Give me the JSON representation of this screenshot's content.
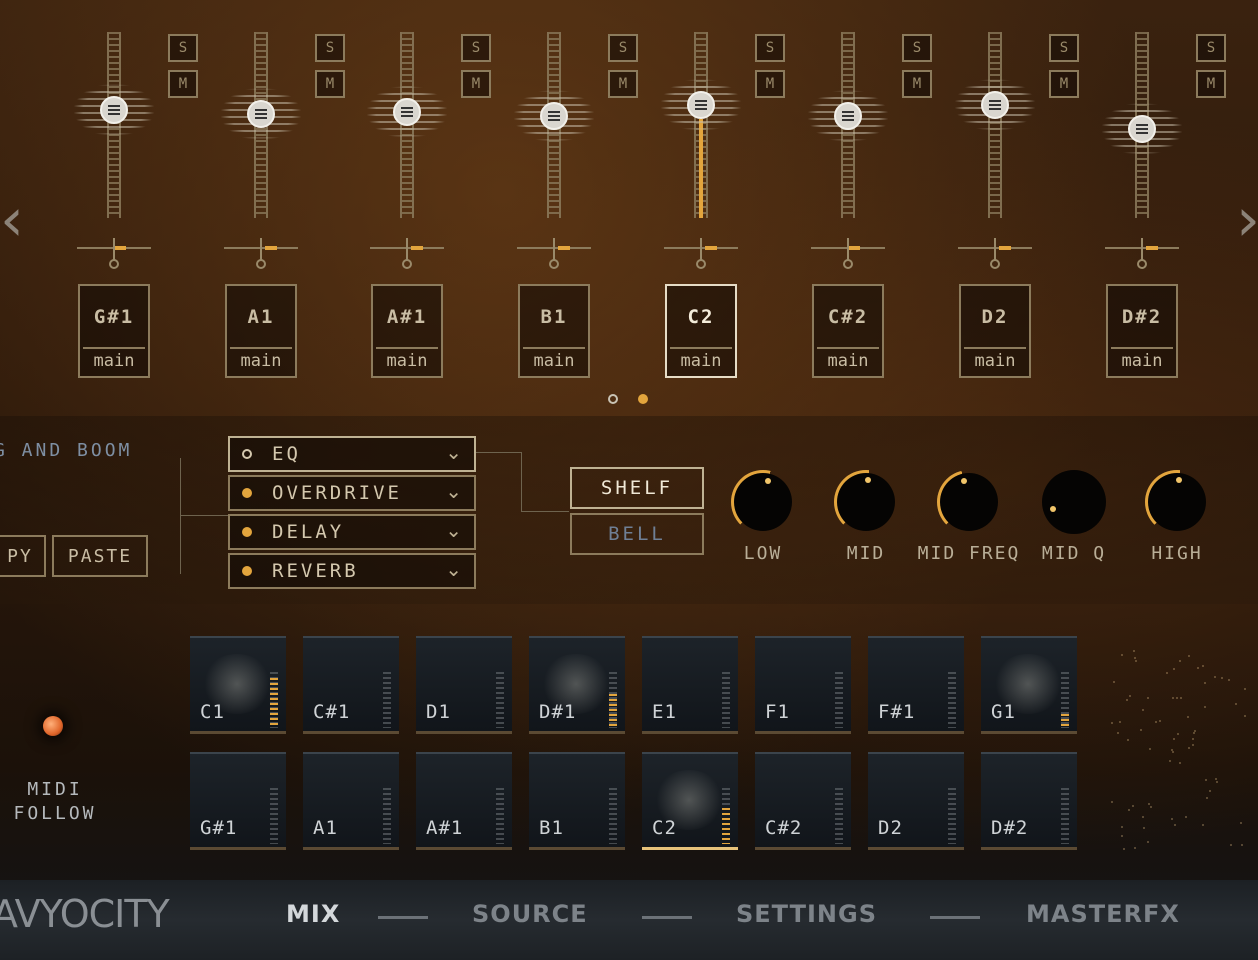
{
  "strips": [
    {
      "note": "G#1",
      "output": "main",
      "fader": 0.58,
      "active": false
    },
    {
      "note": "A1",
      "output": "main",
      "fader": 0.56,
      "active": false
    },
    {
      "note": "A#1",
      "output": "main",
      "fader": 0.57,
      "active": false
    },
    {
      "note": "B1",
      "output": "main",
      "fader": 0.55,
      "active": false
    },
    {
      "note": "C2",
      "output": "main",
      "fader": 0.61,
      "active": true
    },
    {
      "note": "C#2",
      "output": "main",
      "fader": 0.55,
      "active": false
    },
    {
      "note": "D2",
      "output": "main",
      "fader": 0.61,
      "active": false
    },
    {
      "note": "D#2",
      "output": "main",
      "fader": 0.48,
      "active": false
    }
  ],
  "solo_label": "S",
  "mute_label": "M",
  "pager": {
    "pages": 2,
    "current": 2
  },
  "preset_name": "G AND BOOM",
  "copy_label": "PY",
  "paste_label": "PASTE",
  "fx_chain": [
    {
      "name": "EQ",
      "enabled": false,
      "selected": true
    },
    {
      "name": "OVERDRIVE",
      "enabled": true,
      "selected": false
    },
    {
      "name": "DELAY",
      "enabled": true,
      "selected": false
    },
    {
      "name": "REVERB",
      "enabled": true,
      "selected": false
    }
  ],
  "eq": {
    "shelf_label": "SHELF",
    "bell_label": "BELL",
    "mode": "SHELF",
    "knobs": [
      {
        "label": "LOW",
        "value": 0.55
      },
      {
        "label": "MID",
        "value": 0.52
      },
      {
        "label": "MID FREQ",
        "value": 0.45
      },
      {
        "label": "MID Q",
        "value": 0.1
      },
      {
        "label": "HIGH",
        "value": 0.52
      }
    ]
  },
  "pads": [
    {
      "label": "C1",
      "level": 0.9,
      "glow": true
    },
    {
      "label": "C#1",
      "level": 0,
      "glow": false
    },
    {
      "label": "D1",
      "level": 0,
      "glow": false
    },
    {
      "label": "D#1",
      "level": 0.6,
      "glow": true
    },
    {
      "label": "E1",
      "level": 0,
      "glow": false
    },
    {
      "label": "F1",
      "level": 0,
      "glow": false
    },
    {
      "label": "F#1",
      "level": 0,
      "glow": false
    },
    {
      "label": "G1",
      "level": 0.25,
      "glow": true
    },
    {
      "label": "G#1",
      "level": 0,
      "glow": false
    },
    {
      "label": "A1",
      "level": 0,
      "glow": false
    },
    {
      "label": "A#1",
      "level": 0,
      "glow": false
    },
    {
      "label": "B1",
      "level": 0,
      "glow": false
    },
    {
      "label": "C2",
      "level": 0.65,
      "glow": true,
      "active": true
    },
    {
      "label": "C#2",
      "level": 0,
      "glow": false
    },
    {
      "label": "D2",
      "level": 0,
      "glow": false
    },
    {
      "label": "D#2",
      "level": 0,
      "glow": false
    }
  ],
  "midi_follow": {
    "line1": "MIDI",
    "line2": "FOLLOW",
    "on": true
  },
  "logo_text": "AVYOCITY",
  "tabs": [
    {
      "label": "MIX",
      "active": true
    },
    {
      "label": "SOURCE",
      "active": false
    },
    {
      "label": "SETTINGS",
      "active": false
    },
    {
      "label": "MASTERFX",
      "active": false
    }
  ],
  "colors": {
    "accent": "#e3a53d",
    "frame": "#8c7b5c",
    "text": "#c9bda4"
  },
  "icons": {
    "prev": "chevron-left-icon",
    "next": "chevron-right-icon",
    "dropdown": "chevron-down-icon"
  }
}
